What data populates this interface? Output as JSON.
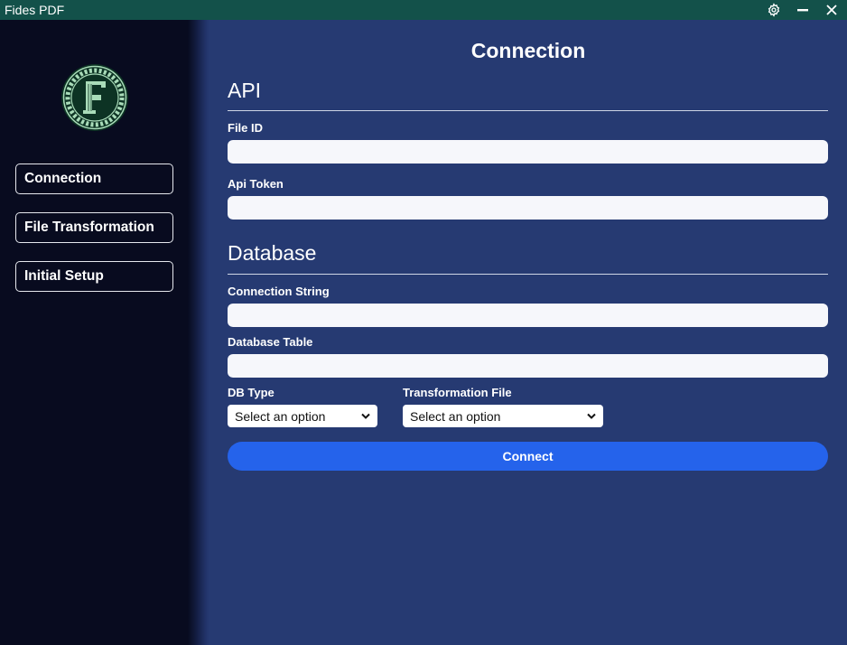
{
  "window": {
    "title": "Fides PDF"
  },
  "sidebar": {
    "nav": [
      {
        "label": "Connection"
      },
      {
        "label": "File Transformation"
      },
      {
        "label": "Initial Setup"
      }
    ]
  },
  "main": {
    "title": "Connection",
    "api": {
      "heading": "API",
      "file_id": {
        "label": "File ID",
        "value": ""
      },
      "api_token": {
        "label": "Api Token",
        "value": ""
      }
    },
    "database": {
      "heading": "Database",
      "connection_string": {
        "label": "Connection String",
        "value": ""
      },
      "database_table": {
        "label": "Database Table",
        "value": ""
      },
      "db_type": {
        "label": "DB Type",
        "selected": "Select an option"
      },
      "transformation_file": {
        "label": "Transformation File",
        "selected": "Select an option"
      }
    },
    "connect_label": "Connect"
  },
  "colors": {
    "titlebar": "#13514a",
    "sidebar": "#080b1f",
    "main_bg": "#263a72",
    "accent": "#2563eb",
    "logo_green": "#a9dcb9"
  },
  "icons": {
    "settings": "gear-icon",
    "minimize": "minimize-icon",
    "close": "close-icon",
    "logo": "fides-logo-icon",
    "select_arrow": "chevron-down-icon"
  }
}
